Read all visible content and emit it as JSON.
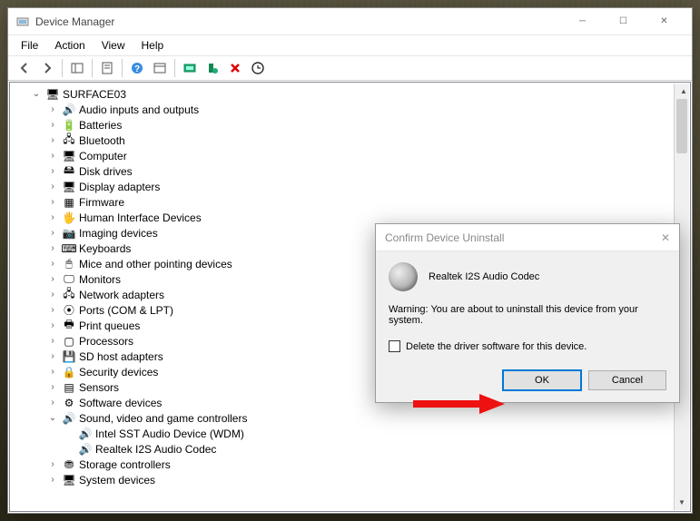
{
  "window": {
    "title": "Device Manager",
    "menu": [
      "File",
      "Action",
      "View",
      "Help"
    ]
  },
  "tree": {
    "root": "SURFACE03",
    "items": [
      {
        "label": "Audio inputs and outputs",
        "icon": "🔊"
      },
      {
        "label": "Batteries",
        "icon": "🔋"
      },
      {
        "label": "Bluetooth",
        "icon": "🖧"
      },
      {
        "label": "Computer",
        "icon": "🖥"
      },
      {
        "label": "Disk drives",
        "icon": "🖴"
      },
      {
        "label": "Display adapters",
        "icon": "🖥"
      },
      {
        "label": "Firmware",
        "icon": "▦"
      },
      {
        "label": "Human Interface Devices",
        "icon": "🖐"
      },
      {
        "label": "Imaging devices",
        "icon": "📷"
      },
      {
        "label": "Keyboards",
        "icon": "⌨"
      },
      {
        "label": "Mice and other pointing devices",
        "icon": "🖱"
      },
      {
        "label": "Monitors",
        "icon": "🖵"
      },
      {
        "label": "Network adapters",
        "icon": "🖧"
      },
      {
        "label": "Ports (COM & LPT)",
        "icon": "⦿"
      },
      {
        "label": "Print queues",
        "icon": "🖶"
      },
      {
        "label": "Processors",
        "icon": "▢"
      },
      {
        "label": "SD host adapters",
        "icon": "💾"
      },
      {
        "label": "Security devices",
        "icon": "🔒"
      },
      {
        "label": "Sensors",
        "icon": "▤"
      },
      {
        "label": "Software devices",
        "icon": "⚙"
      },
      {
        "label": "Sound, video and game controllers",
        "icon": "🔊",
        "expanded": true,
        "children": [
          {
            "label": "Intel SST Audio Device (WDM)",
            "icon": "🔊"
          },
          {
            "label": "Realtek I2S Audio Codec",
            "icon": "🔊"
          }
        ]
      },
      {
        "label": "Storage controllers",
        "icon": "⛃"
      },
      {
        "label": "System devices",
        "icon": "🖥"
      }
    ]
  },
  "dialog": {
    "title": "Confirm Device Uninstall",
    "device": "Realtek I2S Audio Codec",
    "warning": "Warning: You are about to uninstall this device from your system.",
    "checkbox": "Delete the driver software for this device.",
    "ok": "OK",
    "cancel": "Cancel"
  }
}
